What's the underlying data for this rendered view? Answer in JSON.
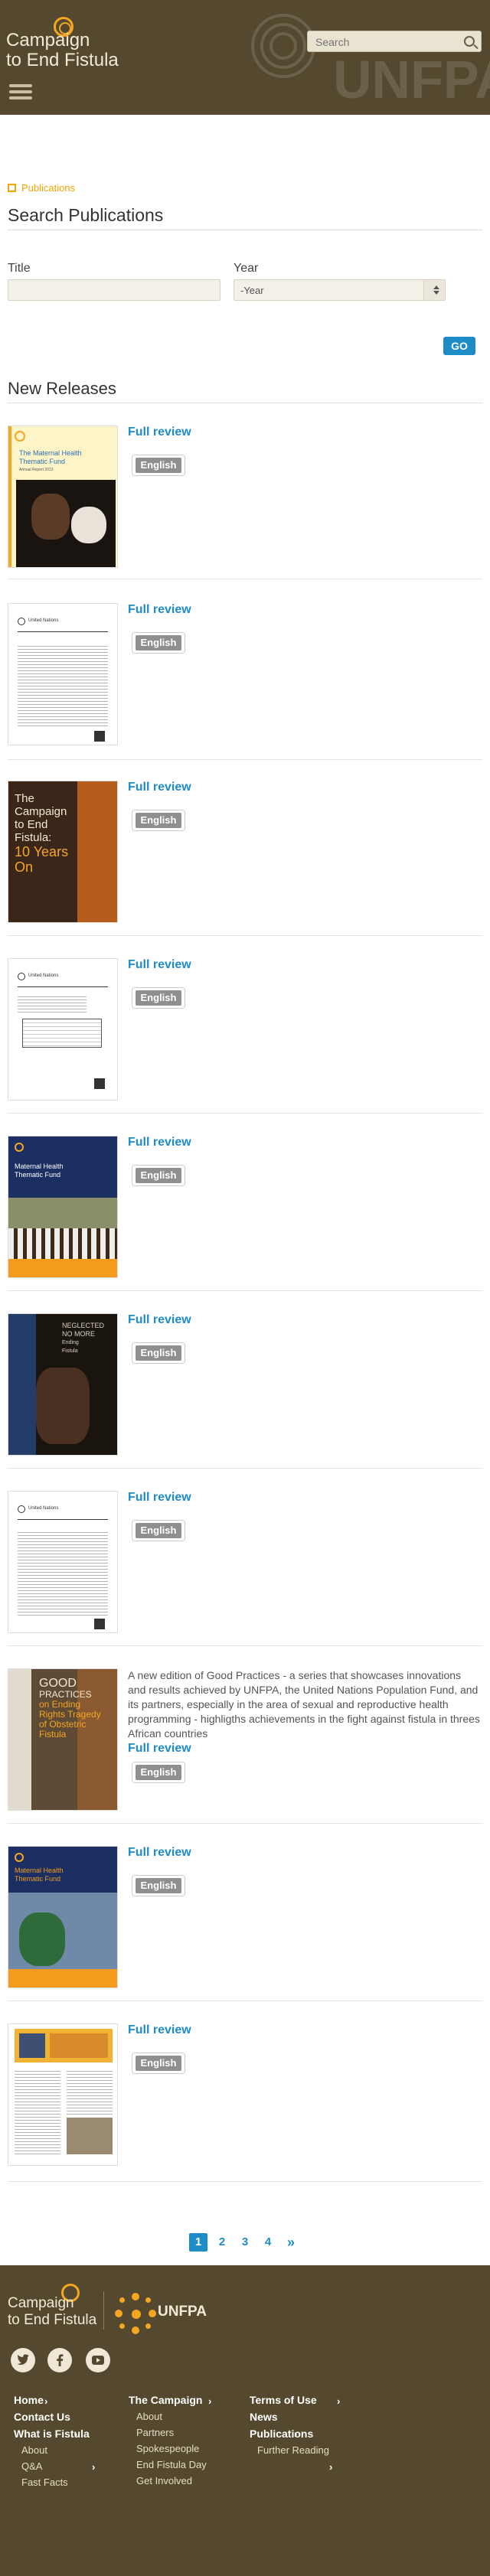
{
  "header": {
    "logo_line1": "Campaign",
    "logo_line2": "to End Fistula",
    "search_placeholder": "Search",
    "watermark_text": "UNFPA"
  },
  "breadcrumb": "Publications",
  "page_title": "Search Publications",
  "form": {
    "title_label": "Title",
    "title_value": "",
    "year_label": "Year",
    "year_value": "-Year",
    "go_label": "GO"
  },
  "section_title": "New Releases",
  "items": [
    {
      "cover_text": [
        "The Maternal Health",
        "Thematic Fund",
        "Annual Report 2013"
      ],
      "review_label": "Full review",
      "lang_label": "English",
      "description": ""
    },
    {
      "cover_text": [
        "United Nations"
      ],
      "review_label": "Full review",
      "lang_label": "English",
      "description": ""
    },
    {
      "cover_text": [
        "The",
        "Campaign",
        "to End",
        "Fistula:",
        "10 Years",
        "On"
      ],
      "review_label": "Full review",
      "lang_label": "English",
      "description": ""
    },
    {
      "cover_text": [
        "United Nations"
      ],
      "review_label": "Full review",
      "lang_label": "English",
      "description": ""
    },
    {
      "cover_text": [
        "Maternal Health",
        "Thematic Fund"
      ],
      "review_label": "Full review",
      "lang_label": "English",
      "description": ""
    },
    {
      "cover_text": [
        "NEGLECTED",
        "NO MORE",
        "Ending",
        "Fistula"
      ],
      "review_label": "Full review",
      "lang_label": "English",
      "description": ""
    },
    {
      "cover_text": [
        "United Nations"
      ],
      "review_label": "Full review",
      "lang_label": "English",
      "description": ""
    },
    {
      "cover_text": [
        "GOOD",
        "PRACTICES",
        "on Ending",
        "Rights Tragedy",
        "of Obstetric",
        "Fistula"
      ],
      "review_label": "Full review",
      "lang_label": "English",
      "description": "A new edition of Good Practices - a series that showcases innovations and results achieved by UNFPA, the United Nations Population Fund, and its partners, especially in the area of sexual and reproductive health programming - highligths achievements in the fight against fistula in threes African countries"
    },
    {
      "cover_text": [
        "Maternal Health",
        "Thematic Fund"
      ],
      "review_label": "Full review",
      "lang_label": "English",
      "description": ""
    },
    {
      "cover_text": [],
      "review_label": "Full review",
      "lang_label": "English",
      "description": ""
    }
  ],
  "pagination": {
    "pages": [
      "1",
      "2",
      "3",
      "4"
    ],
    "next": "»",
    "active": "1"
  },
  "footer": {
    "logo_line1": "Campaign",
    "logo_line2": "to End Fistula",
    "partner": "UNFPA",
    "social": {
      "twitter": "twitter-icon",
      "facebook": "facebook-icon",
      "youtube": "youtube-icon"
    },
    "col1": {
      "home": "Home",
      "contact": "Contact Us",
      "what": "What is Fistula",
      "about": "About",
      "qa": "Q&A",
      "facts": "Fast Facts"
    },
    "col2": {
      "campaign": "The Campaign",
      "about": "About",
      "partners": "Partners",
      "spokespeople": "Spokespeople",
      "day": "End Fistula Day",
      "involved": "Get Involved"
    },
    "col3": {
      "terms": "Terms of Use",
      "news": "News",
      "publications": "Publications",
      "reading": "Further Reading"
    }
  },
  "colors": {
    "header_bg": "#54492f",
    "accent": "#f5a623",
    "link": "#1d8cc9"
  }
}
